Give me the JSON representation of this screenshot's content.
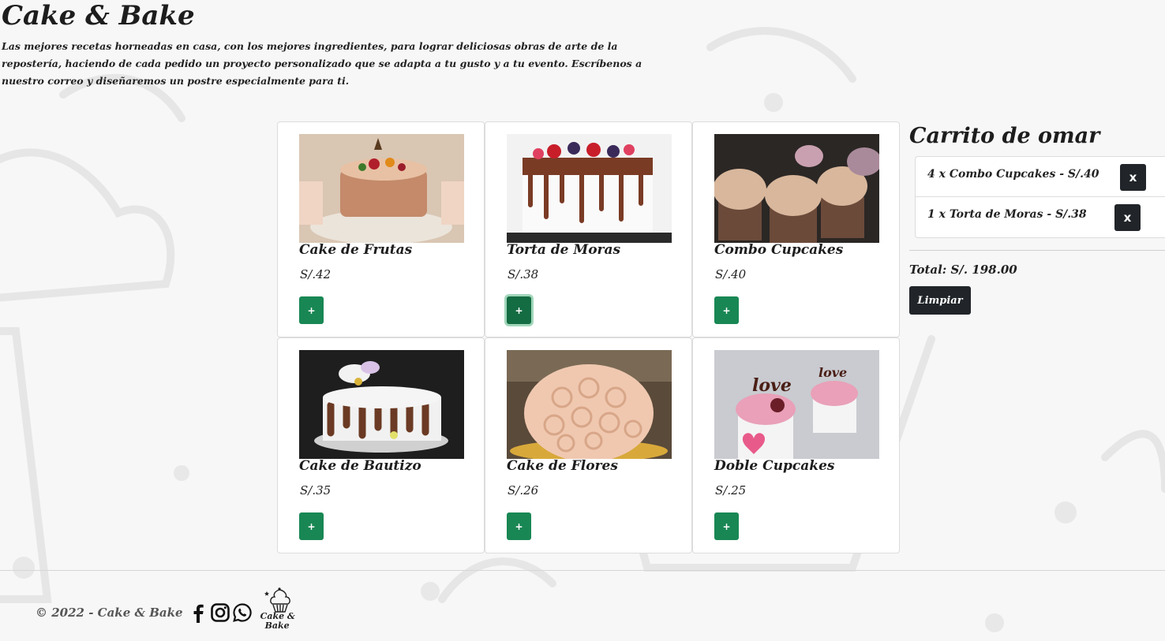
{
  "header": {
    "title": "Cake & Bake",
    "intro": "Las mejores recetas horneadas en casa, con los mejores ingredientes, para lograr deliciosas obras de arte de la repostería, haciendo de cada pedido un proyecto personalizado que se adapta a tu gusto y a tu evento. Escríbenos a nuestro correo y diseñaremos un postre especialmente para ti."
  },
  "products": [
    {
      "name": "Cake de Frutas",
      "price": "S/.42",
      "add_label": "+"
    },
    {
      "name": "Torta de Moras",
      "price": "S/.38",
      "add_label": "+"
    },
    {
      "name": "Combo Cupcakes",
      "price": "S/.40",
      "add_label": "+"
    },
    {
      "name": "Cake de Bautizo",
      "price": "S/.35",
      "add_label": "+"
    },
    {
      "name": "Cake de Flores",
      "price": "S/.26",
      "add_label": "+"
    },
    {
      "name": "Doble Cupcakes",
      "price": "S/.25",
      "add_label": "+"
    }
  ],
  "cart": {
    "title": "Carrito de omar",
    "items": [
      {
        "text": "4 x Combo Cupcakes - S/.40",
        "remove_label": "x"
      },
      {
        "text": "1 x Torta de Moras - S/.38",
        "remove_label": "x"
      }
    ],
    "total": "Total: S/. 198.00",
    "clear_label": "Limpiar"
  },
  "footer": {
    "copyright": "© 2022 - Cake & Bake",
    "social_icons": [
      "facebook-icon",
      "instagram-icon",
      "whatsapp-icon"
    ],
    "logo_line1": "Cake &",
    "logo_line2": "Bake"
  },
  "colors": {
    "add_button": "#198754",
    "dark_button": "#212529",
    "background": "#f7f7f7"
  }
}
